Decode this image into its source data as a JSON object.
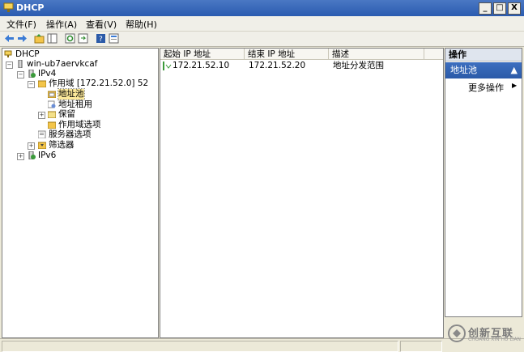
{
  "window": {
    "title": "DHCP",
    "controls": {
      "minimize": "_",
      "maximize": "□",
      "close": "X"
    }
  },
  "menu": [
    {
      "label": "文件(F)"
    },
    {
      "label": "操作(A)"
    },
    {
      "label": "查看(V)"
    },
    {
      "label": "帮助(H)"
    }
  ],
  "toolbar": {
    "icons": [
      "back-arrow-icon",
      "forward-arrow-icon",
      "up-folder-icon",
      "show-hide-tree-icon",
      "refresh-icon",
      "export-list-icon",
      "help-icon",
      "properties-icon"
    ]
  },
  "tree": {
    "root": "DHCP",
    "server": "win-ub7aervkcaf",
    "ipv4": "IPv4",
    "scope": "作用域 [172.21.52.0] 52",
    "address_pool": "地址池",
    "address_leases": "地址租用",
    "reservations": "保留",
    "scope_options": "作用域选项",
    "server_options": "服务器选项",
    "filters": "筛选器",
    "ipv6": "IPv6"
  },
  "list": {
    "columns": [
      "起始 IP 地址",
      "结束 IP 地址",
      "描述"
    ],
    "rows": [
      {
        "start_ip": "172.21.52.10",
        "end_ip": "172.21.52.20",
        "description": "地址分发范围"
      }
    ]
  },
  "actions": {
    "header": "操作",
    "section": "地址池",
    "more": "更多操作"
  },
  "watermark": {
    "text": "创新互联",
    "sub": "CHUANG XIN HU LIAN"
  },
  "colors": {
    "title_bar": "#2a5bb0",
    "selection": "#fce99a",
    "action_section": "#2b5aa8"
  }
}
